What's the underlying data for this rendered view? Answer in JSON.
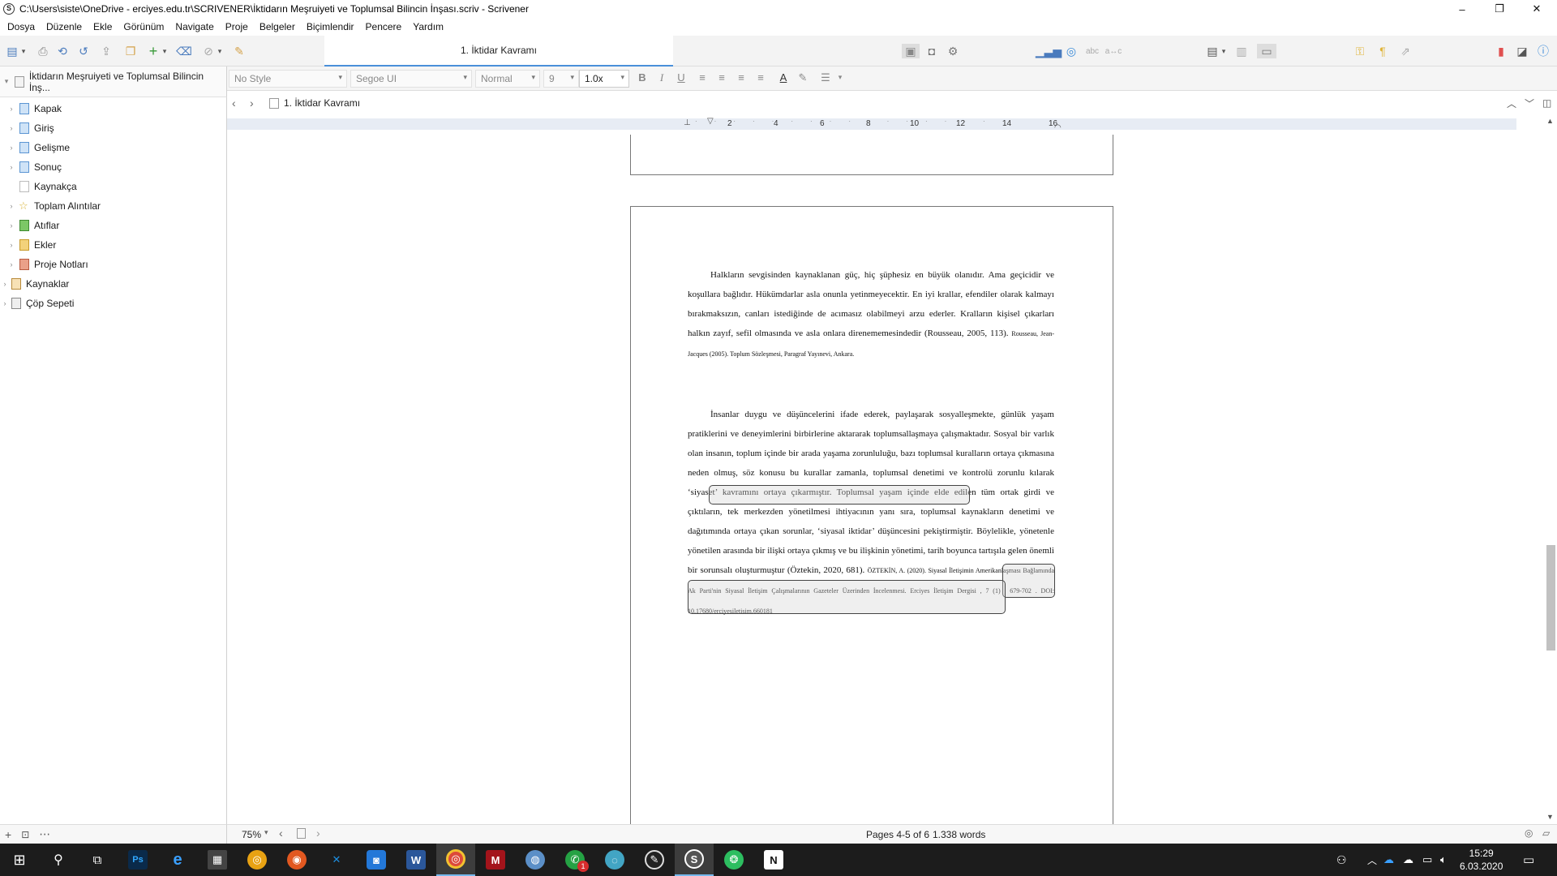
{
  "window": {
    "title": "C:\\Users\\siste\\OneDrive - erciyes.edu.tr\\SCRIVENER\\İktidarın Meşruiyeti ve Toplumsal Bilincin İnşası.scriv - Scrivener",
    "app_icon": "S",
    "minimize": "–",
    "restore": "❐",
    "close": "✕"
  },
  "menu": [
    "Dosya",
    "Düzenle",
    "Ekle",
    "Görünüm",
    "Navigate",
    "Proje",
    "Belgeler",
    "Biçimlendir",
    "Pencere",
    "Yardım"
  ],
  "toolbar": {
    "document_tab": "1. İktidar Kavramı"
  },
  "binder": {
    "project": "İktidarın Meşruiyeti ve Toplumsal Bilincin İnş...",
    "items": [
      {
        "label": "Kapak",
        "icon": "document-icon",
        "color": "#5b95d3"
      },
      {
        "label": "Giriş",
        "icon": "document-icon",
        "color": "#5b95d3"
      },
      {
        "label": "Gelişme",
        "icon": "document-icon",
        "color": "#5b95d3"
      },
      {
        "label": "Sonuç",
        "icon": "document-icon",
        "color": "#5b95d3"
      },
      {
        "label": "Kaynakça",
        "icon": "blank-page-icon",
        "color": "#bbbbbb"
      },
      {
        "label": "Toplam Alıntılar",
        "icon": "star-icon",
        "color": "#d9b43a"
      },
      {
        "label": "Atıflar",
        "icon": "green-folder-icon",
        "color": "#5aa845"
      },
      {
        "label": "Ekler",
        "icon": "yellow-folder-icon",
        "color": "#e3b640"
      },
      {
        "label": "Proje Notları",
        "icon": "notebook-icon",
        "color": "#d8765b"
      }
    ],
    "root_items": [
      {
        "label": "Kaynaklar",
        "icon": "research-folder-icon"
      },
      {
        "label": "Çöp Sepeti",
        "icon": "trash-icon"
      }
    ]
  },
  "format": {
    "style": "No Style",
    "font": "Segoe UI",
    "weight": "Normal",
    "size": "9",
    "line_spacing": "1.0x"
  },
  "header": {
    "doc_title": "1. İktidar Kavramı"
  },
  "ruler": {
    "ticks": [
      "2",
      "4",
      "6",
      "8",
      "10",
      "12",
      "14",
      "16"
    ]
  },
  "document": {
    "p1_text": "Halkların sevgisinden kaynaklanan güç, hiç şüphesiz en büyük olanıdır. Ama geçicidir ve koşullara bağlıdır. Hükümdarlar asla onunla yetinmeyecektir. En iyi krallar, efendiler olarak kalmayı bırakmaksızın, canları istediğinde de acımasız olabilmeyi arzu ederler. Kralların kişisel çıkarları halkın zayıf, sefil olmasında ve asla onlara direnememesindedir (Rousseau, 2005, 113).",
    "p1_note": "Rousseau, Jean-Jacques (2005). Toplum Sözleşmesi, Paragraf Yayınevi, Ankara.",
    "p2_text": "İnsanlar duygu ve düşüncelerini ifade ederek, paylaşarak sosyalleşmekte, günlük yaşam pratiklerini ve deneyimlerini birbirlerine aktararak toplumsallaşmaya çalışmaktadır. Sosyal bir varlık olan insanın, toplum içinde bir arada yaşama zorunluluğu, bazı toplumsal kuralların ortaya çıkmasına neden olmuş, söz konusu bu kurallar zamanla, toplumsal denetimi ve kontrolü zorunlu kılarak ‘siyaset’ kavramını ortaya çıkarmıştır. Toplumsal yaşam içinde elde edilen tüm ortak girdi ve çıktıların, tek merkezden yönetilmesi ihtiyacının yanı sıra, toplumsal kaynakların denetimi ve dağıtımında ortaya çıkan sorunlar, ‘siyasal iktidar’ düşüncesini pekiştirmiştir. Böylelikle, yönetenle yönetilen arasında bir ilişki ortaya çıkmış ve bu ilişkinin yönetimi, tarih boyunca tartışıla gelen önemli bir sorunsalı oluşturmuştur (Öztekin, 2020, 681).",
    "p2_note": "ÖZTEKİN, A. (2020). Siyasal İletişimin Amerikanlaşması Bağlamında Ak Parti'nin Siyasal İletişim Çalışmalarının Gazeteler Üzerinden İncelenmesi. Erciyes İletişim Dergisi , 7 (1) , 679-702 . DOI: 10.17680/erciyesiletisim.660181"
  },
  "status": {
    "zoom": "75%",
    "pages": "Pages 4-5 of 6",
    "words": "1.338 words"
  },
  "taskbar": {
    "apps": [
      {
        "name": "photoshop",
        "label": "Ps",
        "color": "#0a2a4a"
      },
      {
        "name": "edge",
        "label": "e",
        "color": "#1570c4"
      },
      {
        "name": "calculator",
        "label": "▦",
        "color": "#444444"
      },
      {
        "name": "chrome-canary",
        "label": "◎",
        "color": "#e8a213"
      },
      {
        "name": "firefox",
        "label": "◉",
        "color": "#e25820"
      },
      {
        "name": "xcode",
        "label": "✕",
        "color": "#1d6fd1"
      },
      {
        "name": "camera",
        "label": "◙",
        "color": "#2378d8"
      },
      {
        "name": "word",
        "label": "W",
        "color": "#2b579a"
      },
      {
        "name": "chrome",
        "label": "◎",
        "color": "#dd4a3a"
      },
      {
        "name": "mendeley",
        "label": "M",
        "color": "#a4141b"
      },
      {
        "name": "teams-like",
        "label": "◍",
        "color": "#5b8fc7"
      },
      {
        "name": "whatsapp",
        "label": "✆",
        "color": "#25a244"
      },
      {
        "name": "network",
        "label": "◌",
        "color": "#42a5c4"
      },
      {
        "name": "inkscape",
        "label": "✎",
        "color": "#222222"
      },
      {
        "name": "scrivener",
        "label": "S",
        "color": "#555555"
      },
      {
        "name": "evernote",
        "label": "❂",
        "color": "#2dbe60"
      },
      {
        "name": "notion",
        "label": "N",
        "color": "#ffffff"
      }
    ],
    "whatsapp_badge": "1",
    "time": "15:29",
    "date": "6.03.2020"
  }
}
